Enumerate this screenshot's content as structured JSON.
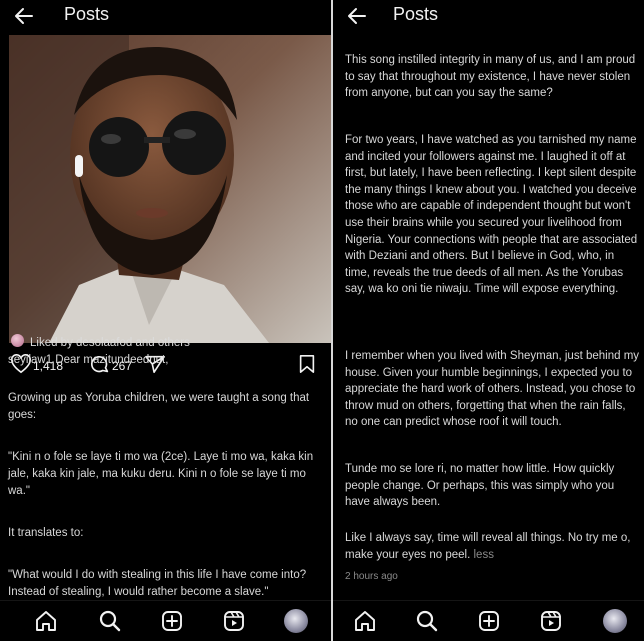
{
  "left": {
    "header": {
      "title": "Posts"
    },
    "post": {
      "likes": "1,418",
      "comments": "267",
      "liked_by": "Liked by desolaafod and others",
      "caption_first": "seyilaw1 Dear mazitundeednut,",
      "paragraphs": [
        "Growing up as Yoruba children, we were taught a song that goes:",
        "\"Kini n o fole se laye ti mo wa (2ce). Laye ti mo wa, kaka kin jale, kaka kin jale, ma kuku deru. Kini n o fole se laye ti mo wa.\"",
        "It translates to:",
        "\"What would I do with stealing in this life I have come into? Instead of stealing, I would rather become a slave.\""
      ]
    },
    "nav": [
      "home-icon",
      "search-icon",
      "create-icon",
      "reels-icon",
      "profile-avatar"
    ]
  },
  "right": {
    "header": {
      "title": "Posts"
    },
    "paragraphs": [
      "This song instilled integrity in many of us, and I am proud to say that throughout my existence, I have never stolen from anyone, but can you say the same?",
      "For two years, I have watched as you tarnished my name and incited your followers against me. I laughed it off at first, but lately, I have been reflecting. I kept silent despite the many things I knew about you. I watched you deceive those who are capable of independent thought but won't use their brains while you secured your livelihood from Nigeria. Your connections with people that are associated with Deziani and others. But I believe in God, who, in time, reveals the true deeds of all men. As the Yorubas say, wa ko oni tie niwaju. Time will expose everything.",
      "I remember when you lived with Sheyman, just behind my house. Given your humble beginnings, I expected you to appreciate the hard work of others. Instead, you chose to throw mud on others, forgetting that when the rain falls, no one can predict whose roof it will touch.",
      "Tunde mo se lore ri, no matter how little. How quickly people change. Or perhaps, this was simply who you have always been.",
      "Like I always say, time will reveal all things. No try me o, make your eyes no peel."
    ],
    "less_label": "less",
    "timestamp": "2 hours ago"
  },
  "colors": {
    "background": "#000000",
    "text": "#e8e8e8",
    "muted": "#8a8a8a"
  }
}
